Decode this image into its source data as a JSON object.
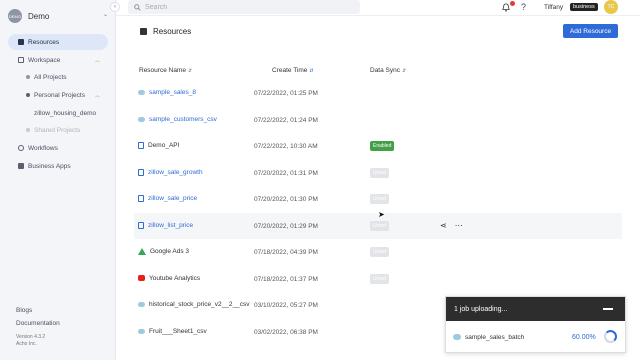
{
  "org": {
    "name": "Demo",
    "avatar": "DEMO"
  },
  "sidebar": {
    "items": [
      {
        "label": "Resources",
        "icon": "resources-icon"
      },
      {
        "label": "Workspace",
        "icon": "workspace-icon"
      },
      {
        "label": "All Projects",
        "icon": "projects-icon"
      },
      {
        "label": "Personal Projects",
        "icon": "person-icon"
      },
      {
        "label": "zillow_housing_demo"
      },
      {
        "label": "Shared Projects",
        "icon": "share-icon"
      },
      {
        "label": "Workflows",
        "icon": "workflow-icon"
      },
      {
        "label": "Business Apps",
        "icon": "apps-icon"
      }
    ],
    "footer": {
      "blogs": "Blogs",
      "documentation": "Documentation",
      "version": "Version 4.3.2",
      "company": "Acho Inc."
    }
  },
  "topbar": {
    "search_placeholder": "Search",
    "user_name": "Tiffany",
    "plan": "business",
    "user_initials": "TC"
  },
  "page": {
    "title": "Resources",
    "add_button": "Add Resource"
  },
  "table": {
    "headers": {
      "name": "Resource Name",
      "time": "Create Time",
      "sync": "Data Sync"
    },
    "rows": [
      {
        "name": "sample_sales_8",
        "time": "07/22/2022, 01:25 PM",
        "type": "csv",
        "link": true,
        "sync": ""
      },
      {
        "name": "sample_customers_csv",
        "time": "07/22/2022, 01:24 PM",
        "type": "csv",
        "link": true,
        "sync": ""
      },
      {
        "name": "Demo_API",
        "time": "07/22/2022, 10:30 AM",
        "type": "doc",
        "link": false,
        "sync": "Enabled"
      },
      {
        "name": "zillow_sale_growth",
        "time": "07/20/2022, 01:31 PM",
        "type": "doc",
        "link": true,
        "sync": "Unset"
      },
      {
        "name": "zillow_sale_price",
        "time": "07/20/2022, 01:30 PM",
        "type": "doc",
        "link": true,
        "sync": "Unset"
      },
      {
        "name": "zillow_list_price",
        "time": "07/20/2022, 01:29 PM",
        "type": "doc",
        "link": true,
        "sync": "Unset"
      },
      {
        "name": "Google Ads 3",
        "time": "07/18/2022, 04:39 PM",
        "type": "gads",
        "link": false,
        "sync": "Unset"
      },
      {
        "name": "Youtube Analytics",
        "time": "07/18/2022, 01:37 PM",
        "type": "youtube",
        "link": false,
        "sync": "Unset"
      },
      {
        "name": "historical_stock_price_v2__2__csv",
        "time": "03/10/2022, 05:27 PM",
        "type": "csv",
        "link": false,
        "sync": ""
      },
      {
        "name": "Fruit___Sheet1_csv",
        "time": "03/02/2022, 06:38 PM",
        "type": "csv",
        "link": false,
        "sync": ""
      }
    ]
  },
  "upload": {
    "title": "1 job uploading...",
    "file": "sample_sales_batch",
    "progress": "60.00%"
  },
  "colors": {
    "accent": "#2f6bd6",
    "enabled": "#43a047",
    "sidebar_active": "#dde7f7"
  }
}
